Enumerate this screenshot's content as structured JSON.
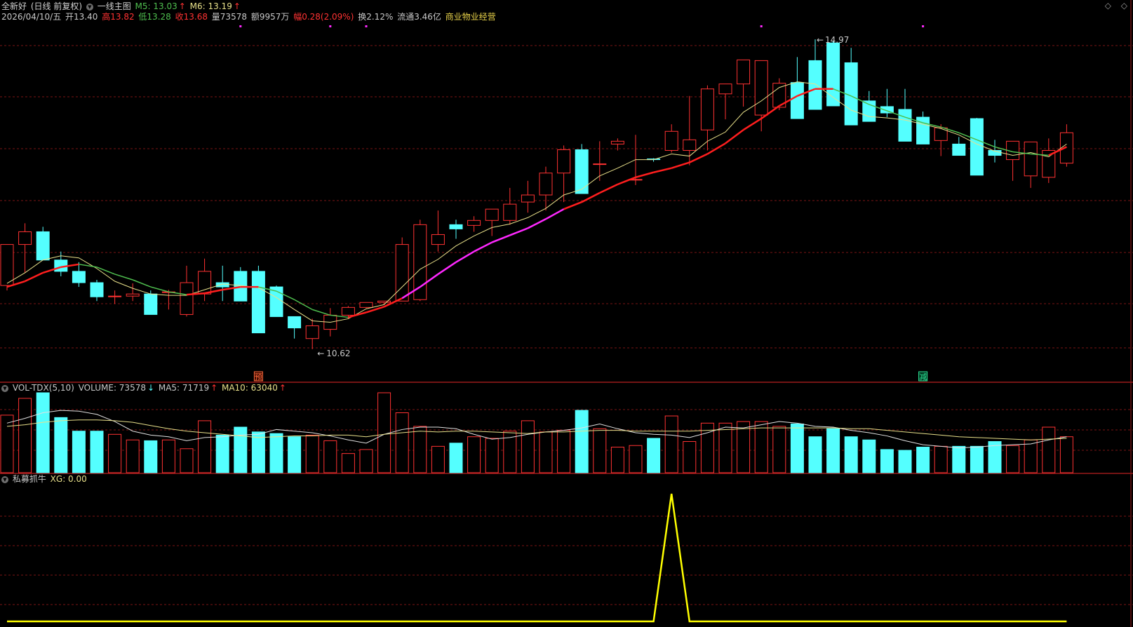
{
  "header": {
    "name": "全新好",
    "period": "(日线 前复权)",
    "indicator": "一线主图",
    "m5_label": "M5: 13.03",
    "m6_label": "M6: 13.19",
    "date": "2026/04/10/五",
    "open": "开13.40",
    "high": "高13.82",
    "low": "低13.28",
    "close": "收13.68",
    "volume": "量73578",
    "amount": "额9957万",
    "change": "幅0.28(2.09%)",
    "turnover": "换2.12%",
    "float_cap": "流通3.46亿",
    "industry": "商业物业经营"
  },
  "vol_header": {
    "name": "VOL-TDX(5,10)",
    "volume": "VOLUME: 73578",
    "ma5": "MA5: 71719",
    "ma10": "MA10: 63040"
  },
  "xg_header": {
    "name": "私募抓牛",
    "xg": "XG: 0.00"
  },
  "colors": {
    "up": "#ff3232",
    "down": "#54ffff",
    "ma_yellow": "#e8e08a",
    "ma_green": "#4fbf4f",
    "ma_red": "#ff1e1e",
    "ma_magenta": "#ff28ff",
    "signal": "#ffff00",
    "grid": "#7a1414"
  },
  "chart_data": [
    {
      "type": "candlestick",
      "panel": "price",
      "ylim": [
        10.4,
        15.2
      ],
      "x": [
        1,
        2,
        3,
        4,
        5,
        6,
        7,
        8,
        9,
        10,
        11,
        12,
        13,
        14,
        15,
        16,
        17,
        18,
        19,
        20,
        21,
        22,
        23,
        24,
        25,
        26,
        27,
        28,
        29,
        30,
        31,
        32,
        33,
        34,
        35,
        36,
        37,
        38,
        39,
        40,
        41,
        42,
        43,
        44,
        45,
        46,
        47,
        48,
        49,
        50,
        51,
        52,
        53,
        54,
        55,
        56,
        57,
        58,
        59,
        60
      ],
      "open": [
        11.52,
        12.1,
        12.28,
        11.88,
        11.72,
        11.56,
        11.36,
        11.37,
        11.4,
        11.43,
        11.11,
        11.4,
        11.56,
        11.72,
        11.72,
        11.5,
        11.08,
        10.77,
        10.9,
        11.1,
        11.21,
        11.28,
        11.3,
        11.32,
        12.1,
        12.38,
        12.37,
        12.44,
        12.44,
        12.7,
        12.8,
        13.11,
        13.44,
        13.24,
        13.52,
        13.01,
        13.31,
        13.43,
        13.43,
        13.72,
        14.23,
        14.37,
        13.93,
        14.04,
        14.39,
        14.7,
        14.95,
        14.67,
        14.13,
        14.05,
        14.01,
        13.9,
        13.57,
        13.52,
        13.88,
        13.43,
        13.3,
        13.07,
        13.05,
        13.25
      ],
      "high": [
        12.1,
        12.4,
        12.35,
        12.0,
        11.85,
        11.6,
        11.45,
        11.55,
        11.45,
        11.46,
        11.8,
        11.9,
        11.8,
        11.78,
        11.8,
        11.52,
        11.08,
        11.05,
        11.2,
        11.23,
        11.28,
        11.3,
        12.2,
        12.45,
        12.58,
        12.45,
        12.5,
        12.6,
        12.9,
        13.0,
        13.2,
        13.5,
        13.52,
        13.56,
        13.6,
        13.65,
        13.32,
        13.8,
        14.2,
        14.35,
        14.3,
        14.45,
        14.25,
        14.45,
        14.75,
        15.0,
        14.98,
        14.88,
        14.27,
        14.3,
        14.3,
        13.98,
        13.8,
        13.62,
        13.89,
        13.58,
        13.38,
        13.3,
        13.6,
        13.8
      ],
      "low": [
        11.45,
        11.7,
        11.9,
        11.65,
        11.5,
        11.3,
        11.26,
        11.3,
        11.2,
        11.18,
        11.08,
        11.3,
        11.3,
        11.35,
        11.2,
        11.25,
        10.77,
        10.62,
        10.8,
        11.05,
        11.2,
        11.26,
        11.3,
        11.3,
        12.0,
        12.18,
        12.28,
        12.22,
        12.38,
        12.55,
        12.58,
        12.7,
        13.05,
        13.0,
        13.43,
        12.94,
        13.27,
        13.4,
        13.22,
        13.43,
        13.87,
        14.05,
        13.7,
        14.0,
        14.35,
        14.63,
        14.7,
        14.33,
        13.87,
        13.9,
        13.82,
        13.73,
        13.35,
        13.4,
        13.62,
        13.26,
        13.0,
        12.9,
        12.97,
        13.2
      ],
      "close": [
        12.1,
        12.28,
        11.88,
        11.72,
        11.56,
        11.36,
        11.37,
        11.4,
        11.11,
        11.43,
        11.56,
        11.72,
        11.5,
        11.3,
        10.85,
        11.08,
        10.92,
        10.95,
        11.1,
        11.21,
        11.28,
        11.3,
        12.1,
        12.38,
        12.24,
        12.32,
        12.44,
        12.6,
        12.67,
        12.8,
        13.11,
        13.44,
        12.82,
        13.24,
        13.56,
        13.02,
        13.3,
        13.7,
        13.58,
        14.3,
        14.37,
        14.71,
        14.7,
        14.38,
        13.88,
        14.01,
        14.06,
        13.79,
        13.84,
        13.96,
        13.56,
        13.52,
        13.75,
        13.36,
        13.08,
        13.36,
        13.56,
        13.55,
        13.43,
        13.68
      ]
    },
    {
      "type": "line",
      "panel": "price",
      "series": [
        {
          "name": "M5",
          "values": [
            11.55,
            11.7,
            11.88,
            11.94,
            11.91,
            11.76,
            11.58,
            11.48,
            11.4,
            11.38,
            11.38,
            11.46,
            11.54,
            11.52,
            11.49,
            11.35,
            11.18,
            11.02,
            11.0,
            11.05,
            11.19,
            11.25,
            11.5,
            11.75,
            11.89,
            12.08,
            12.22,
            12.34,
            12.39,
            12.48,
            12.61,
            12.8,
            12.88,
            13.07,
            13.18,
            13.3,
            13.3,
            13.38,
            13.35,
            13.56,
            13.69,
            13.97,
            14.13,
            14.32,
            14.4,
            14.37,
            14.18,
            14.0,
            13.91,
            13.89,
            13.86,
            13.8,
            13.74,
            13.65,
            13.52,
            13.42,
            13.36,
            13.4,
            13.34,
            13.52
          ]
        },
        {
          "name": "M6",
          "values": [
            11.5,
            11.58,
            11.7,
            11.78,
            11.82,
            11.78,
            11.68,
            11.6,
            11.5,
            11.43,
            11.39,
            11.41,
            11.46,
            11.5,
            11.5,
            11.44,
            11.32,
            11.18,
            11.1,
            11.07,
            11.14,
            11.22,
            11.34,
            11.5,
            11.68,
            11.85,
            12.0,
            12.13,
            12.23,
            12.33,
            12.46,
            12.6,
            12.7,
            12.83,
            12.95,
            13.05,
            13.12,
            13.18,
            13.26,
            13.38,
            13.53,
            13.72,
            13.88,
            14.06,
            14.2,
            14.3,
            14.3,
            14.2,
            14.08,
            13.99,
            13.9,
            13.82,
            13.76,
            13.68,
            13.58,
            13.48,
            13.41,
            13.38,
            13.36,
            13.48
          ]
        }
      ]
    },
    {
      "type": "bar",
      "panel": "volume",
      "ylim": [
        0,
        100000
      ],
      "values": [
        72000,
        93000,
        100000,
        69000,
        52000,
        52000,
        48000,
        41000,
        40000,
        41000,
        30000,
        65000,
        47000,
        57000,
        51000,
        49000,
        45000,
        47000,
        40000,
        24000,
        29000,
        100000,
        75000,
        58000,
        33000,
        37000,
        45000,
        43000,
        52000,
        65000,
        51000,
        53000,
        78000,
        55000,
        32000,
        34000,
        43000,
        71000,
        39000,
        62000,
        62000,
        64000,
        64000,
        58000,
        61000,
        45000,
        55000,
        45000,
        41000,
        29000,
        28000,
        32000,
        33000,
        33000,
        33000,
        39000,
        34000,
        41000,
        57000,
        45000
      ],
      "ma5": [
        62000,
        68000,
        75000,
        78000,
        77000,
        73000,
        64000,
        52000,
        47000,
        45000,
        40000,
        44000,
        45000,
        47000,
        48000,
        54000,
        52000,
        50000,
        46000,
        41000,
        37000,
        48000,
        54000,
        57000,
        57000,
        55000,
        48000,
        42000,
        44000,
        48000,
        51000,
        53000,
        56000,
        61000,
        55000,
        50000,
        48000,
        47000,
        44000,
        50000,
        57000,
        56000,
        60000,
        64000,
        62000,
        58000,
        57000,
        53000,
        50000,
        46000,
        40000,
        35000,
        33000,
        31000,
        32000,
        34000,
        35000,
        36000,
        41000,
        45000
      ],
      "ma10": [
        58000,
        60000,
        63000,
        65000,
        66000,
        66000,
        65000,
        63000,
        59000,
        55000,
        52000,
        50000,
        48000,
        46000,
        44000,
        45000,
        46000,
        46000,
        47000,
        47000,
        45000,
        48000,
        50000,
        52000,
        51000,
        52000,
        52000,
        51000,
        50000,
        49000,
        51000,
        51000,
        52000,
        53000,
        53000,
        52000,
        52000,
        52000,
        52000,
        53000,
        54000,
        55000,
        56000,
        56000,
        56000,
        56000,
        56000,
        55000,
        55000,
        53000,
        51000,
        49000,
        47000,
        45000,
        44000,
        43000,
        42000,
        41000,
        42000,
        43000
      ]
    },
    {
      "type": "line",
      "panel": "XG",
      "ylim": [
        0,
        1
      ],
      "series": [
        {
          "name": "XG",
          "values": [
            0,
            0,
            0,
            0,
            0,
            0,
            0,
            0,
            0,
            0,
            0,
            0,
            0,
            0,
            0,
            0,
            0,
            0,
            0,
            0,
            0,
            0,
            0,
            0,
            0,
            0,
            0,
            0,
            0,
            0,
            0,
            0,
            0,
            0,
            0,
            0,
            0,
            1,
            0,
            0,
            0,
            0,
            0,
            0,
            0,
            0,
            0,
            0,
            0,
            0,
            0,
            0,
            0,
            0,
            0,
            0,
            0,
            0,
            0,
            0
          ]
        }
      ]
    }
  ],
  "annotations": {
    "high_label": "14.97",
    "low_label": "10.62",
    "signal_yu": "预",
    "signal_jian": "减"
  },
  "controls": {
    "close_icon": "close-icon",
    "expand_icon": "diamond-icon"
  }
}
